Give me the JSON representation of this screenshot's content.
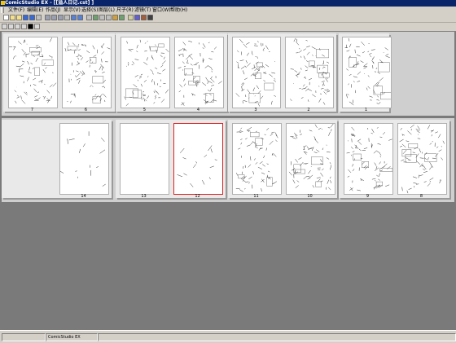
{
  "window": {
    "title": "ComicStudio EX - [[溢人日记.cst] ]"
  },
  "menu": [
    {
      "label": "文件(F)"
    },
    {
      "label": "编辑(E)"
    },
    {
      "label": "作品(J)"
    },
    {
      "label": "显示(V)"
    },
    {
      "label": "选择(S)"
    },
    {
      "label": "图层(L)"
    },
    {
      "label": "尺子(R)"
    },
    {
      "label": "滤镜(T)"
    },
    {
      "label": "窗口(W)"
    },
    {
      "label": "帮助(H)"
    }
  ],
  "toolbar_icons": [
    "new-icon",
    "open-icon",
    "open-story-icon",
    "save-icon",
    "save-all-icon",
    "close-icon",
    "cut-icon",
    "copy-icon",
    "paste-icon",
    "delete-icon",
    "undo-icon",
    "redo-icon",
    "print-icon",
    "export-icon",
    "properties-icon",
    "page-settings-icon",
    "import-icon",
    "page-list-icon",
    "thumbnail-icon",
    "spread-icon",
    "book-icon",
    "help-icon"
  ],
  "toolbar2_icons": [
    "view-mode-icon",
    "single-page-icon",
    "play-icon",
    "rotate-icon",
    "arrow-cursor-icon",
    "hand-icon"
  ],
  "rows": [
    {
      "spreads": [
        {
          "pages": [
            {
              "num": "7",
              "blank": false
            },
            {
              "num": "6",
              "blank": false
            }
          ]
        },
        {
          "pages": [
            {
              "num": "5",
              "blank": false
            },
            {
              "num": "4",
              "blank": false
            }
          ]
        },
        {
          "pages": [
            {
              "num": "3",
              "blank": false
            },
            {
              "num": "2",
              "blank": false
            }
          ],
          "wide": true
        },
        {
          "pages": [
            {
              "num": "1",
              "blank": false
            }
          ]
        }
      ]
    },
    {
      "spreads": [
        {
          "pages": [
            {
              "num": "14",
              "blank": false,
              "sketch": true
            }
          ]
        },
        {
          "pages": [
            {
              "num": "13",
              "blank": true
            },
            {
              "num": "12",
              "blank": false,
              "sketch": true,
              "selected": true
            }
          ]
        },
        {
          "pages": [
            {
              "num": "11",
              "blank": false
            },
            {
              "num": "10",
              "blank": false
            }
          ]
        },
        {
          "pages": [
            {
              "num": "9",
              "blank": false
            },
            {
              "num": "8",
              "blank": false
            }
          ]
        }
      ]
    }
  ],
  "status": {
    "pane1": "",
    "pane2": "ComicStudio EX",
    "pane3": ""
  },
  "colors": {
    "title_bar": "#0a246a",
    "workspace": "#7a7a7a",
    "selection": "#e02020"
  }
}
